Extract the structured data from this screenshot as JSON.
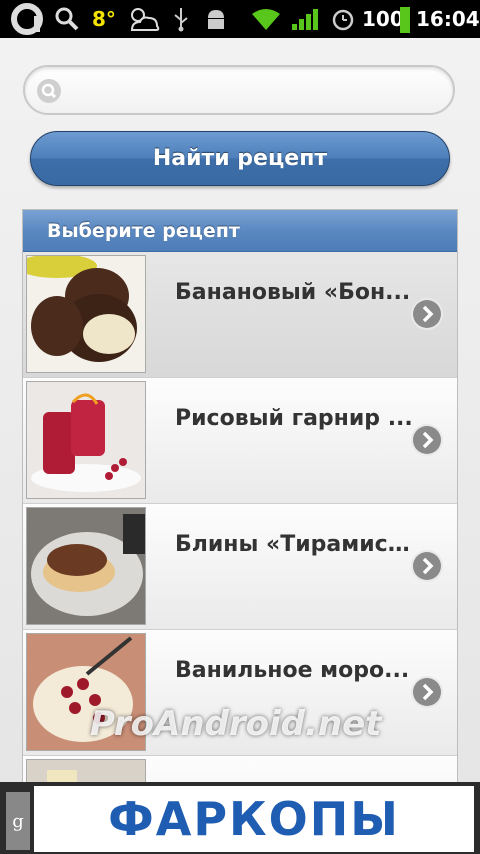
{
  "status_bar": {
    "temperature": "8°",
    "battery": "100",
    "time": "16:04"
  },
  "search": {
    "placeholder": "",
    "value": ""
  },
  "find_button": {
    "label": "Найти рецепт"
  },
  "list": {
    "header": "Выберите рецепт",
    "items": [
      {
        "title": "Банановый «Бон..."
      },
      {
        "title": "Рисовый гарнир ..."
      },
      {
        "title": "Блины «Тирамису»"
      },
      {
        "title": "Ванильное моро..."
      }
    ]
  },
  "ad": {
    "text": "ФАРКОПЫ",
    "badge": "g"
  },
  "watermark": "ProAndroid.net",
  "colors": {
    "accent": "#4f80bb",
    "header": "#5a88c1",
    "ad_text": "#1f5db2"
  }
}
